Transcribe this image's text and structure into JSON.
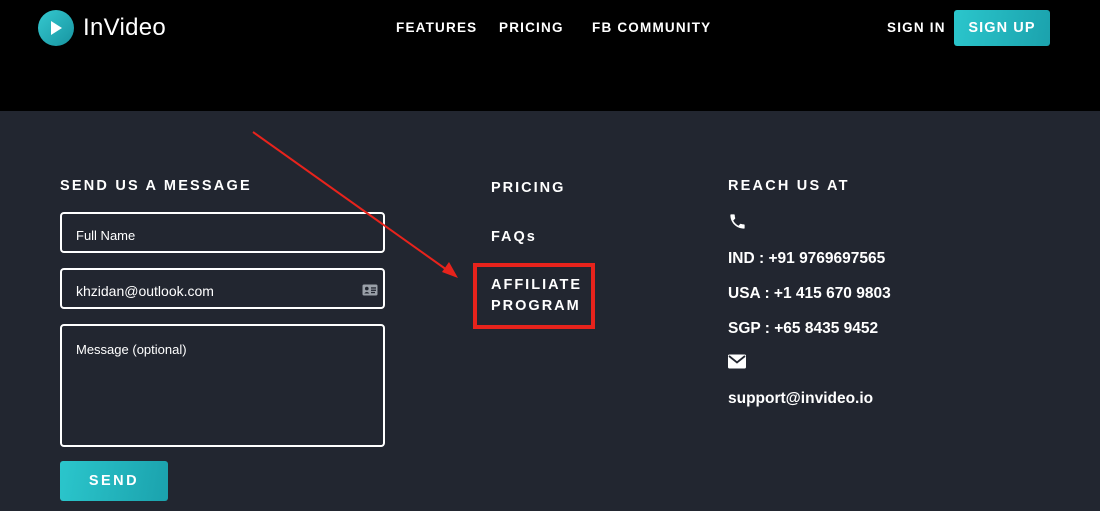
{
  "header": {
    "brand": "InVideo",
    "nav": {
      "features": "FEATURES",
      "pricing": "PRICING",
      "fb_community": "FB COMMUNITY"
    },
    "sign_in": "SIGN IN",
    "sign_up": "SIGN UP"
  },
  "contact_form": {
    "title": "SEND US A MESSAGE",
    "full_name_placeholder": "Full Name",
    "email_value": "khzidan@outlook.com",
    "message_placeholder": "Message (optional)",
    "send_label": "SEND"
  },
  "links": {
    "pricing": "PRICING",
    "faqs": "FAQs",
    "affiliate_line1": "AFFILIATE",
    "affiliate_line2": "PROGRAM"
  },
  "reach_us": {
    "title": "REACH US AT",
    "phone_ind": "IND : +91 9769697565",
    "phone_usa": "USA : +1 415 670 9803",
    "phone_sgp": "SGP : +65 8435 9452",
    "email": "support@invideo.io"
  },
  "colors": {
    "accent": "#2bc6cc",
    "header_bg": "#000000",
    "footer_bg": "#222630",
    "highlight": "#e8231c"
  },
  "icons": {
    "logo": "play-circle-icon",
    "contact_card": "contact-card-icon",
    "phone": "phone-icon",
    "mail": "envelope-icon"
  }
}
